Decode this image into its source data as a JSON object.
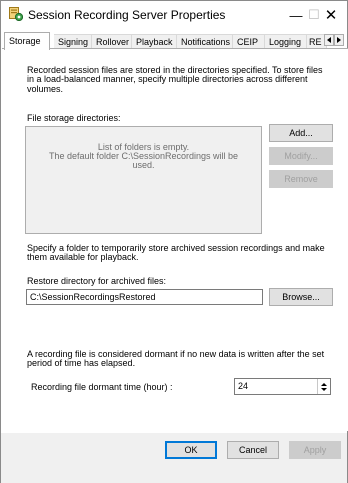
{
  "window": {
    "title": "Session Recording Server Properties",
    "icon": "session-recording-app-icon",
    "controls": {
      "minimize": "—",
      "maximize": "☐",
      "close": "✕"
    }
  },
  "tabs": [
    {
      "label": "Storage",
      "active": true
    },
    {
      "label": "Signing"
    },
    {
      "label": "Rollover"
    },
    {
      "label": "Playback"
    },
    {
      "label": "Notifications"
    },
    {
      "label": "CEIP"
    },
    {
      "label": "Logging"
    },
    {
      "label": "RE"
    }
  ],
  "storage": {
    "intro_line1": "Recorded session files are stored in the directories specified. To store files",
    "intro_line2": "in a load-balanced manner, specify multiple directories across different",
    "intro_line3": "volumes.",
    "file_storage_label": "File storage directories:",
    "list_empty_line1": "List of folders is empty.",
    "list_empty_line2": "The default folder C:\\SessionRecordings will be",
    "list_empty_line3": "used.",
    "add_label": "Add...",
    "modify_label": "Modify...",
    "remove_label": "Remove"
  },
  "restore": {
    "desc_line1": "Specify a folder to temporarily store archived session recordings and make",
    "desc_line2": "them available for playback.",
    "label": "Restore directory for archived files:",
    "value": "C:\\SessionRecordingsRestored",
    "browse_label": "Browse..."
  },
  "dormant": {
    "desc_line1": "A recording file is considered dormant if no new data is written after the set",
    "desc_line2": "period of time has elapsed.",
    "label": "Recording file dormant time (hour) :",
    "value": "24"
  },
  "footer": {
    "ok_label": "OK",
    "cancel_label": "Cancel",
    "apply_label": "Apply"
  },
  "colors": {
    "accent": "#0078d7",
    "disabled_text": "#a0a0a0",
    "face": "#f0f0f0"
  }
}
